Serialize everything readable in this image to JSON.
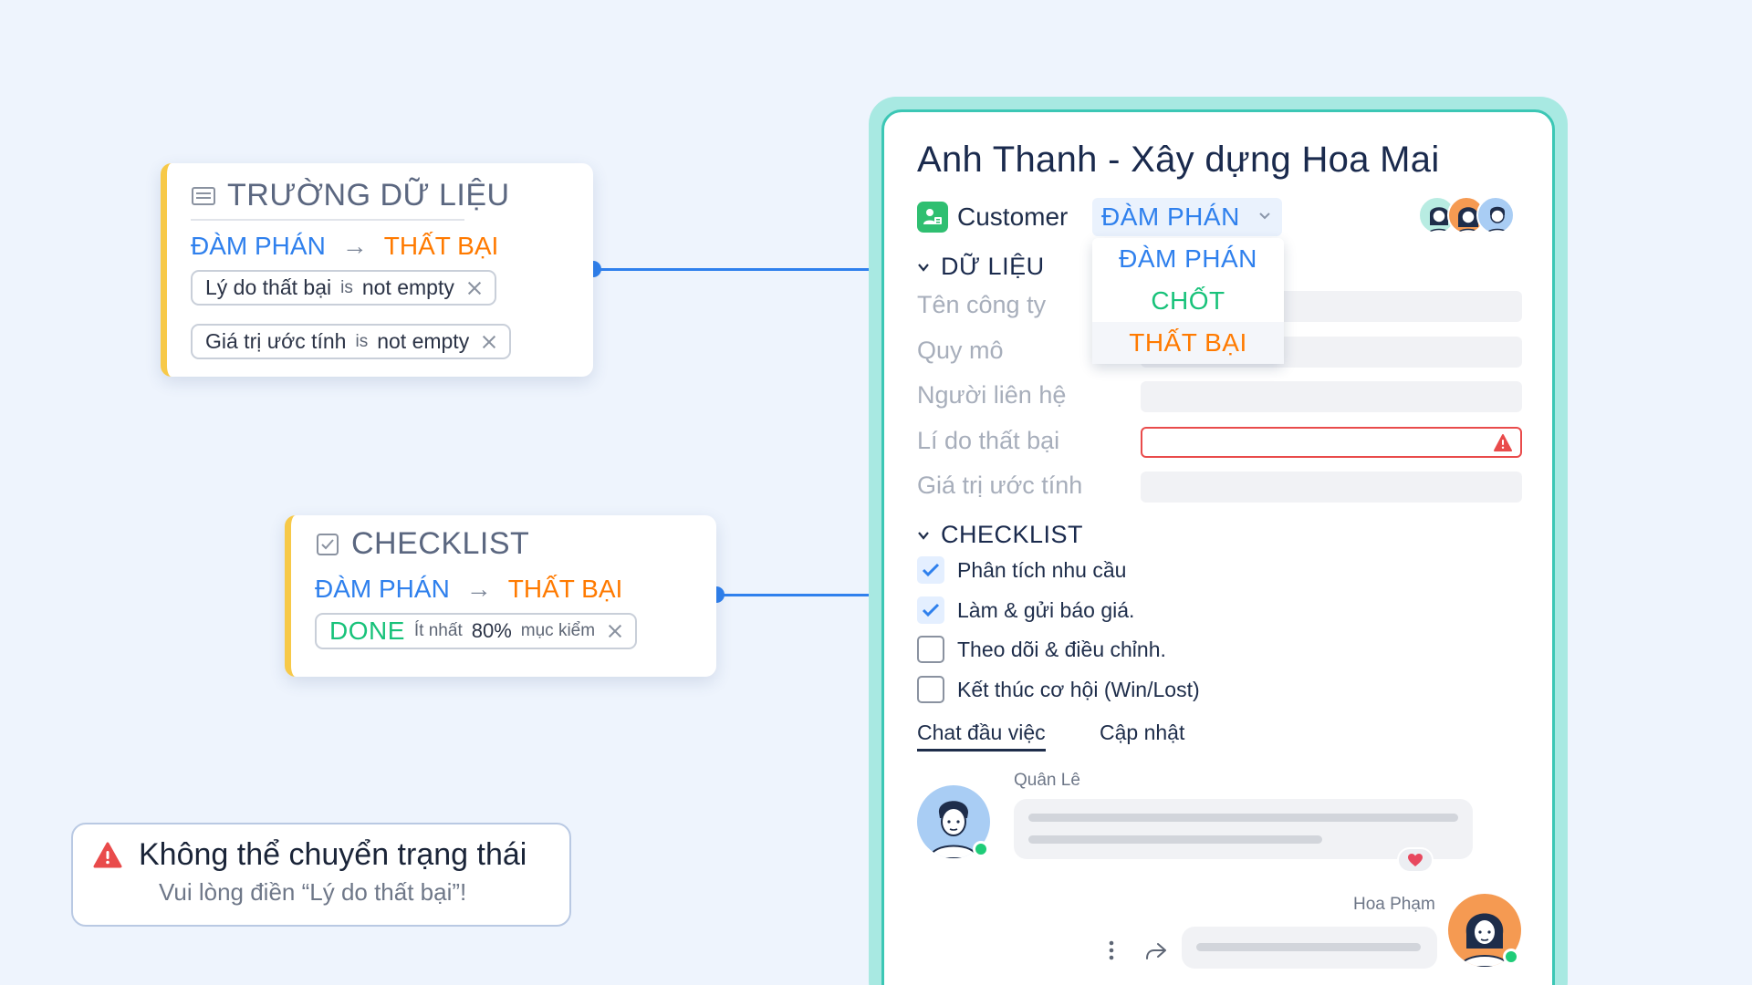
{
  "rule_cards": {
    "data_fields": {
      "title": "TRƯỜNG DỮ LIỆU",
      "icon": "form-fields-icon",
      "from_stage": "ĐÀM PHÁN",
      "to_stage": "THẤT BẠI",
      "conditions": [
        {
          "field": "Lý do thất bại",
          "operator": "is",
          "value": "not empty"
        },
        {
          "field": "Giá trị ước tính",
          "operator": "is",
          "value": "not empty"
        }
      ]
    },
    "checklist": {
      "title": "CHECKLIST",
      "icon": "checkbox-icon",
      "from_stage": "ĐÀM PHÁN",
      "to_stage": "THẤT BẠI",
      "condition": {
        "status": "DONE",
        "prefix": "Ít nhất",
        "percent": "80%",
        "suffix": "mục kiểm"
      }
    }
  },
  "toast": {
    "title": "Không thể chuyển trạng thái",
    "message": "Vui lòng điền “Lý do thất bại”!"
  },
  "deal": {
    "title": "Anh Thanh - Xây dựng Hoa Mai",
    "type_label": "Customer",
    "stage": "ĐÀM PHÁN",
    "stage_options": [
      {
        "label": "ĐÀM PHÁN",
        "color": "#2f80ed"
      },
      {
        "label": "CHỐT",
        "color": "#18c27a"
      },
      {
        "label": "THẤT BẠI",
        "color": "#ff7a00"
      }
    ],
    "data_section": {
      "title": "DỮ LIỆU",
      "fields": [
        {
          "label": "Tên công ty",
          "value": ""
        },
        {
          "label": "Quy mô",
          "value": ""
        },
        {
          "label": "Người liên hệ",
          "value": ""
        },
        {
          "label": "Lí do thất bại",
          "value": "",
          "error": true
        },
        {
          "label": "Giá trị ước tính",
          "value": ""
        }
      ]
    },
    "checklist_section": {
      "title": "CHECKLIST",
      "items": [
        {
          "label": "Phân tích nhu cầu",
          "checked": true
        },
        {
          "label": "Làm & gửi báo giá.",
          "checked": true
        },
        {
          "label": "Theo dõi & điều chỉnh.",
          "checked": false
        },
        {
          "label": "Kết thúc cơ hội (Win/Lost)",
          "checked": false
        }
      ]
    },
    "tabs": [
      "Chat đầu việc",
      "Cập nhật"
    ],
    "active_tab": "Chat đầu việc",
    "messages": [
      {
        "author": "Quân Lê",
        "reaction": "heart"
      },
      {
        "author": "Hoa Phạm"
      }
    ]
  },
  "colors": {
    "accent_blue": "#2f80ed",
    "failed_orange": "#ff7a00",
    "success_green": "#18c27a",
    "error_red": "#e94b4b",
    "rule_border_yellow": "#f7c948",
    "panel_teal": "#3cc7b5"
  }
}
